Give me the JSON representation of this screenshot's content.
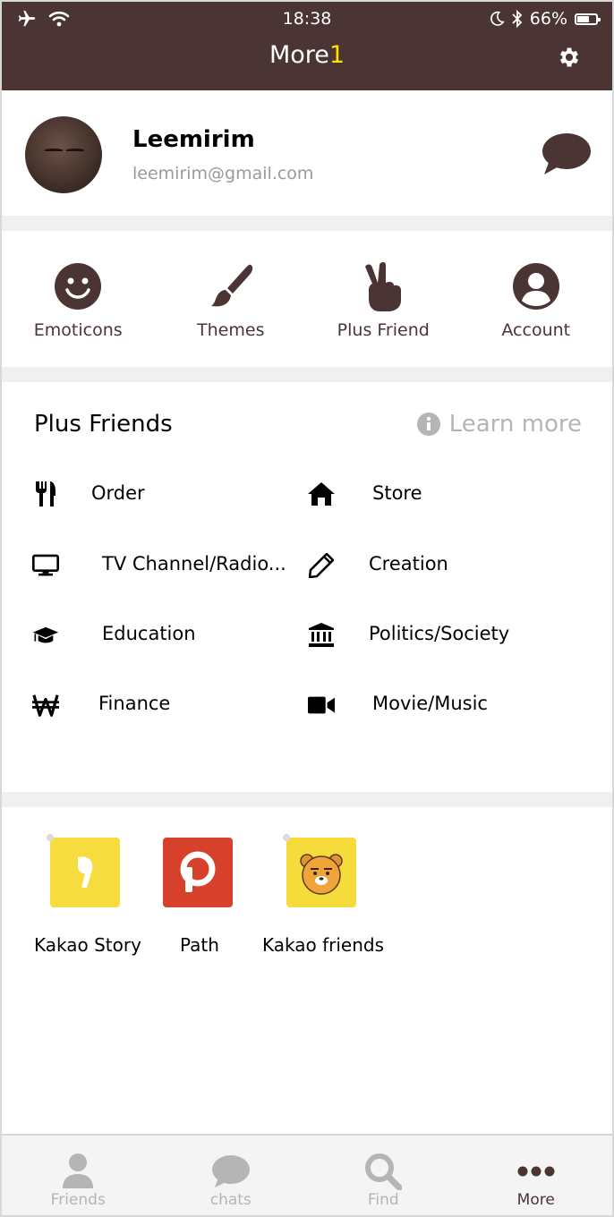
{
  "status_bar": {
    "time": "18:38",
    "battery": "66%",
    "battery_level": 0.66
  },
  "header": {
    "title": "More",
    "badge": "1"
  },
  "profile": {
    "name": "Leemirim",
    "email": "leemirim@gmail.com"
  },
  "quick_tiles": [
    {
      "label": "Emoticons",
      "icon": "smile-icon"
    },
    {
      "label": "Themes",
      "icon": "brush-icon"
    },
    {
      "label": "Plus Friend",
      "icon": "peace-hand-icon"
    },
    {
      "label": "Account",
      "icon": "user-circle-icon"
    }
  ],
  "plus_friends": {
    "title": "Plus Friends",
    "learn_more": "Learn more",
    "categories": [
      {
        "label": "Order",
        "icon": "utensils-icon"
      },
      {
        "label": "Store",
        "icon": "home-icon"
      },
      {
        "label": "TV Channel/Radio...",
        "icon": "monitor-icon"
      },
      {
        "label": "Creation",
        "icon": "pencil-icon"
      },
      {
        "label": "Education",
        "icon": "graduation-cap-icon"
      },
      {
        "label": "Politics/Society",
        "icon": "bank-icon"
      },
      {
        "label": "Finance",
        "icon": "won-icon"
      },
      {
        "label": "Movie/Music",
        "icon": "video-camera-icon"
      }
    ]
  },
  "apps": [
    {
      "label": "Kakao Story",
      "icon": "kakao-story-icon",
      "color": "#f6dc3f"
    },
    {
      "label": "Path",
      "icon": "path-icon",
      "color": "#d7412b"
    },
    {
      "label": "Kakao friends",
      "icon": "kakao-friends-icon",
      "color": "#f5dc3a"
    }
  ],
  "bottom_nav": [
    {
      "label": "Friends",
      "icon": "person-icon",
      "active": false
    },
    {
      "label": "chats",
      "icon": "chat-icon",
      "active": false
    },
    {
      "label": "Find",
      "icon": "search-icon",
      "active": false
    },
    {
      "label": "More",
      "icon": "more-dots-icon",
      "active": true
    }
  ],
  "colors": {
    "brand": "#4b3534",
    "badge": "#ffe100",
    "muted": "#b5b5b5"
  }
}
